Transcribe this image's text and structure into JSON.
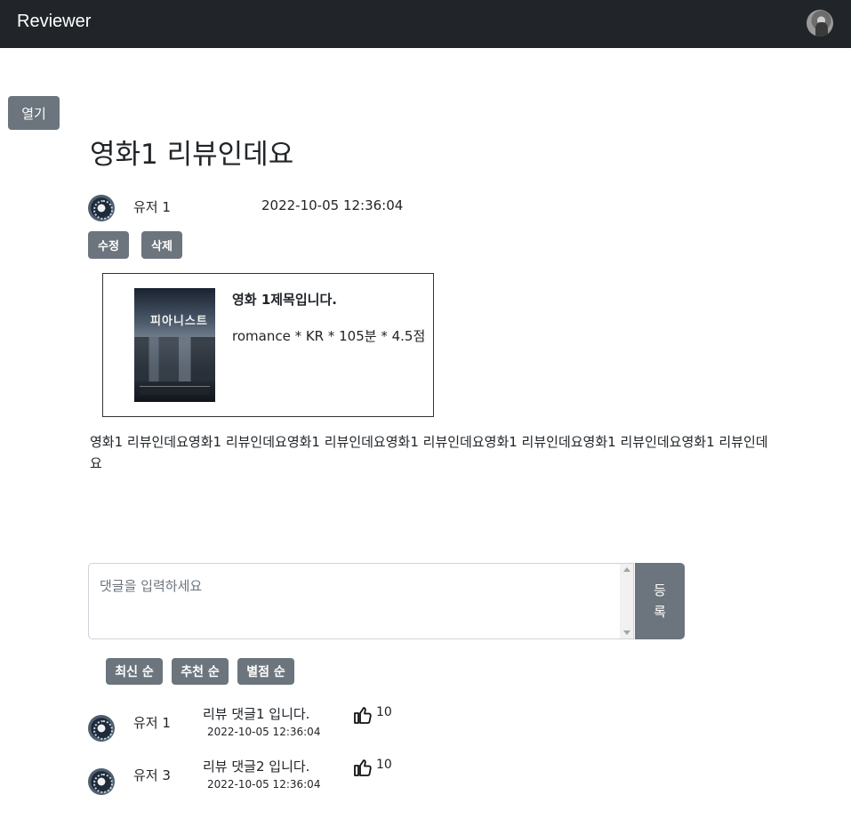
{
  "app": {
    "brand": "Reviewer"
  },
  "sidebar_toggle": {
    "label": "열기"
  },
  "post": {
    "title": "영화1 리뷰인데요",
    "author": "유저 1",
    "date": "2022-10-05 12:36:04",
    "edit_label": "수정",
    "delete_label": "삭제",
    "body": "영화1 리뷰인데요영화1 리뷰인데요영화1 리뷰인데요영화1 리뷰인데요영화1 리뷰인데요영화1 리뷰인데요영화1 리뷰인데요"
  },
  "movie": {
    "title": "영화 1제목입니다.",
    "meta": "romance * KR * 105분 * 4.5점",
    "poster_text": "피아니스트"
  },
  "comment_form": {
    "placeholder": "댓글을 입력하세요",
    "submit_line1": "등",
    "submit_line2": "록"
  },
  "sort": {
    "latest": "최신 순",
    "recommended": "추천 순",
    "rating": "별점 순"
  },
  "comments": [
    {
      "user": "유저 1",
      "text": "리뷰 댓글1 입니다.",
      "date": "2022-10-05 12:36:04",
      "likes": "10"
    },
    {
      "user": "유저 3",
      "text": "리뷰 댓글2 입니다.",
      "date": "2022-10-05 12:36:04",
      "likes": "10"
    }
  ],
  "icons": {
    "nav_avatar": "user-avatar-icon",
    "like": "thumbs-up-icon"
  },
  "colors": {
    "navbar": "#212529",
    "button": "#6c757d"
  }
}
